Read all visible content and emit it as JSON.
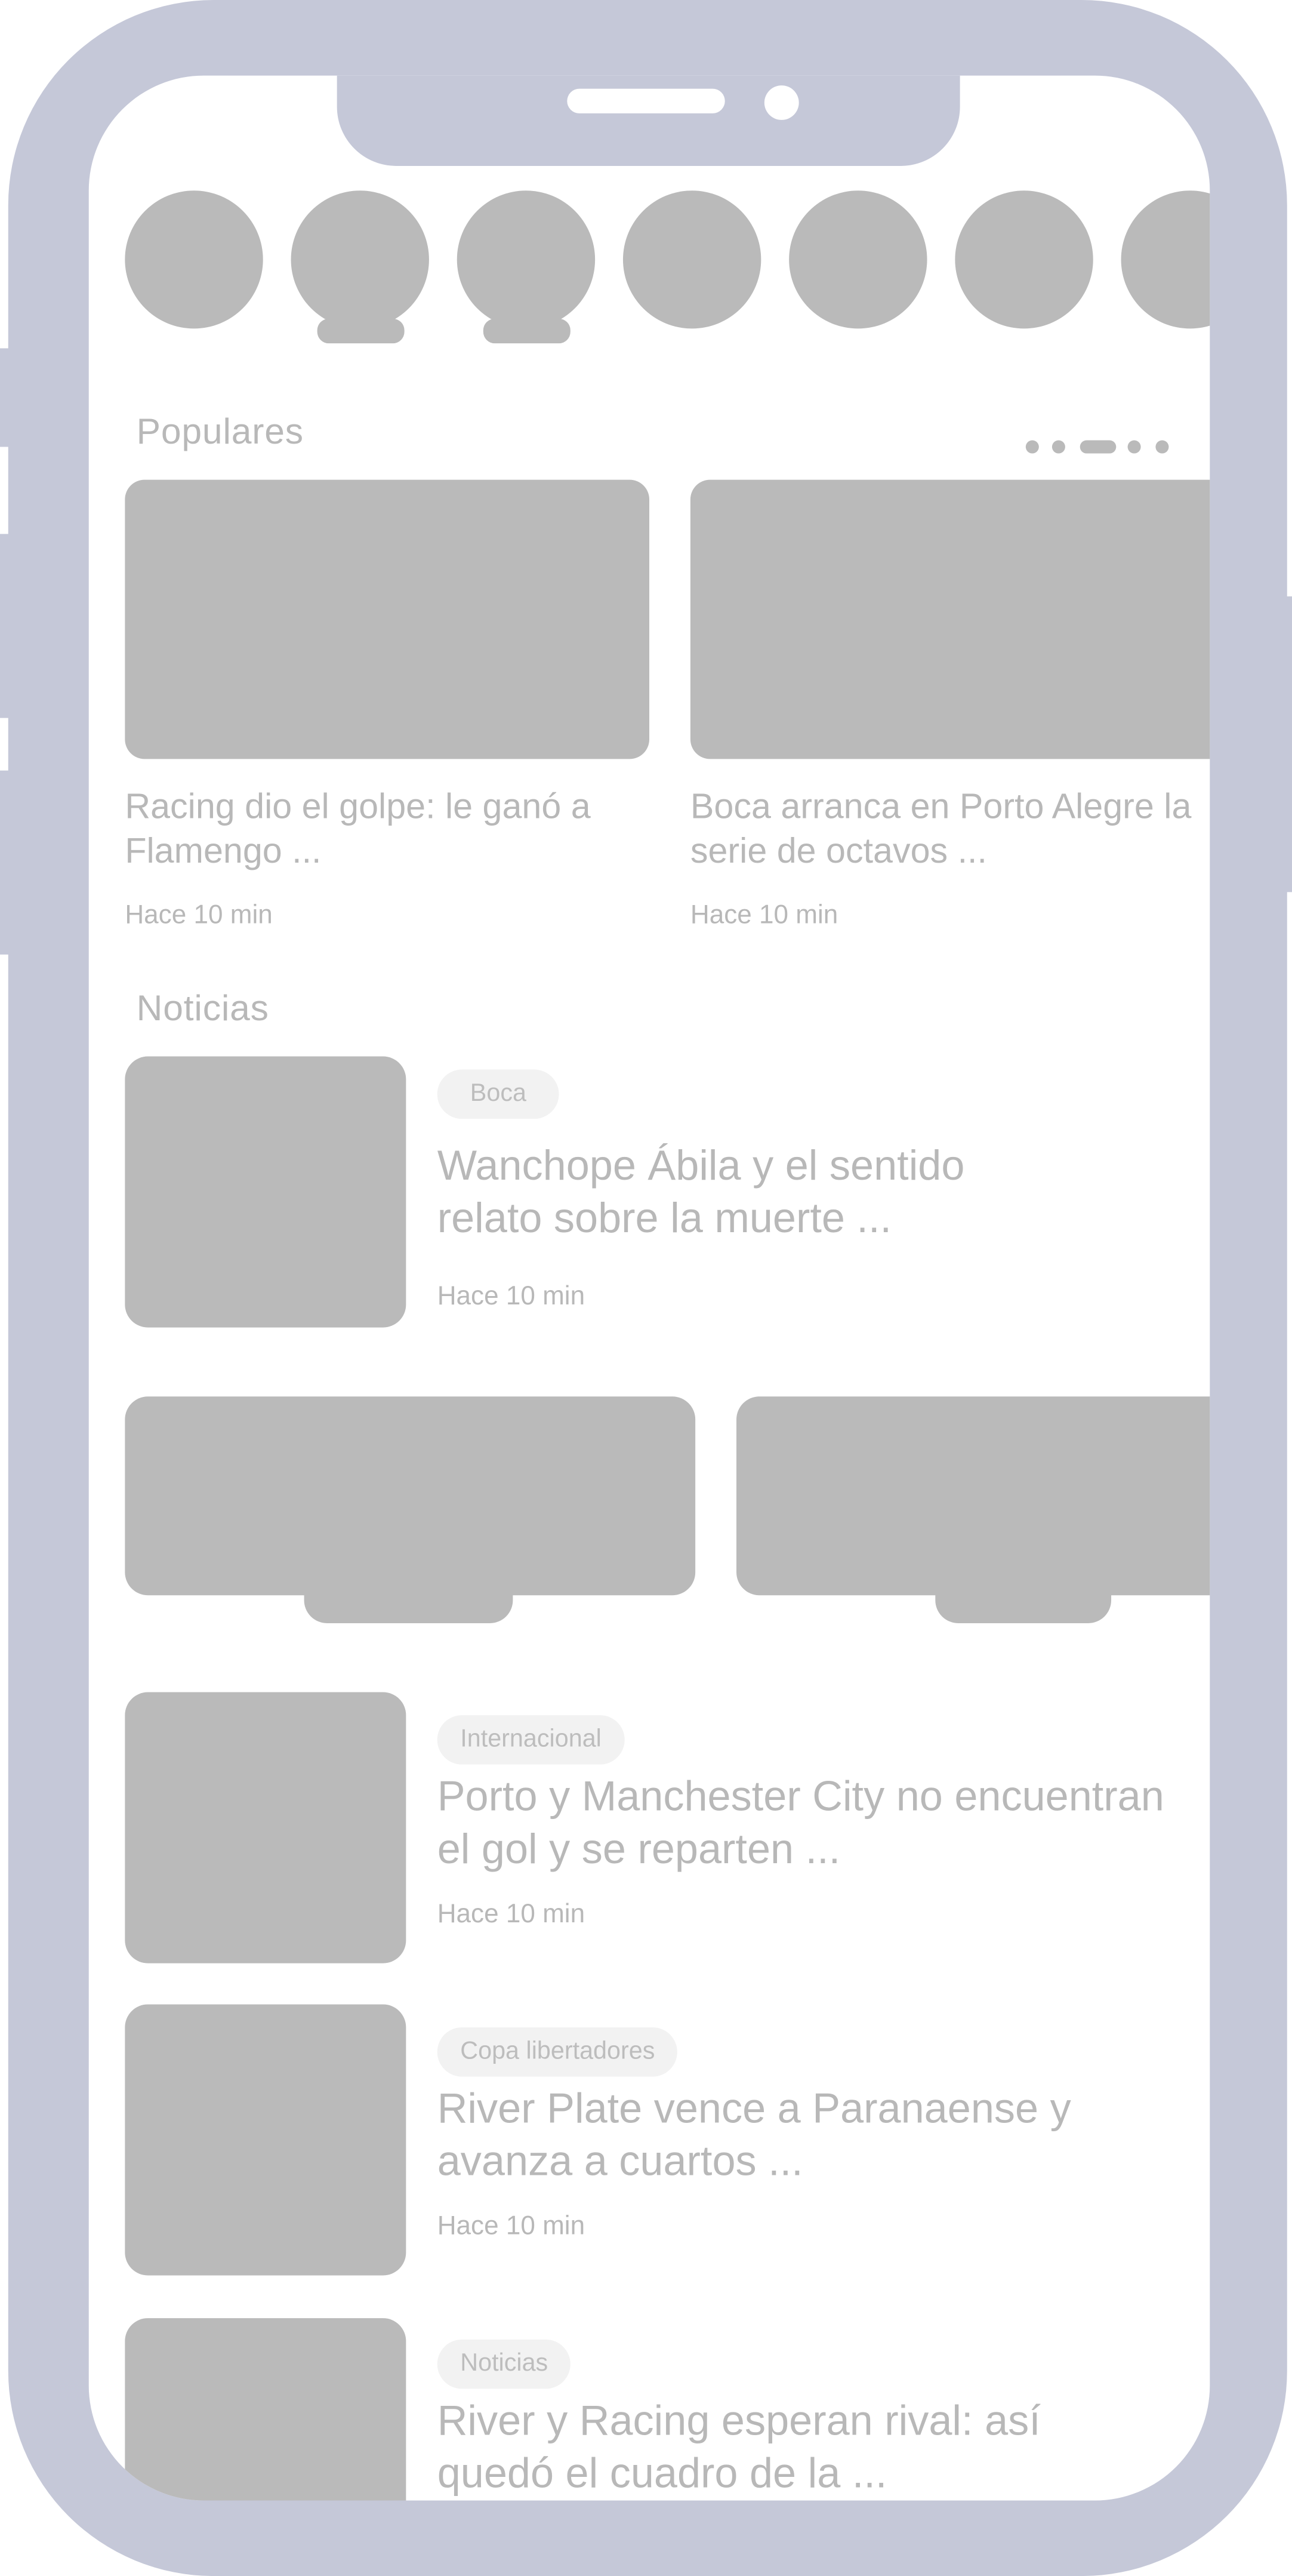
{
  "colors": {
    "frame": "#c5c8d8",
    "placeholder": "#bababa",
    "text": "#b8b8b8",
    "tag_bg": "#f2f2f2"
  },
  "stories": {
    "count": 7
  },
  "popular": {
    "title": "Populares",
    "pager": {
      "count": 5,
      "active_index": 2
    },
    "items": [
      {
        "title": "Racing dio el golpe: le ganó a Flamengo ...",
        "time": "Hace 10 min"
      },
      {
        "title": "Boca arranca en Porto Alegre la serie de octavos ...",
        "time": "Hace 10 min"
      }
    ]
  },
  "news": {
    "title": "Noticias",
    "items": [
      {
        "tag": "Boca",
        "title": "Wanchope Ábila y el sentido relato sobre la muerte ...",
        "time": "Hace 10 min"
      },
      {
        "tag": "Internacional",
        "title": "Porto y Manchester City no encuentran el gol y se reparten ...",
        "time": "Hace 10 min"
      },
      {
        "tag": "Copa libertadores",
        "title": "River Plate vence a Paranaense y avanza a cuartos ...",
        "time": "Hace 10 min"
      },
      {
        "tag": "Noticias",
        "title": "River y Racing esperan rival: así quedó el cuadro de la ...",
        "time": ""
      }
    ]
  }
}
